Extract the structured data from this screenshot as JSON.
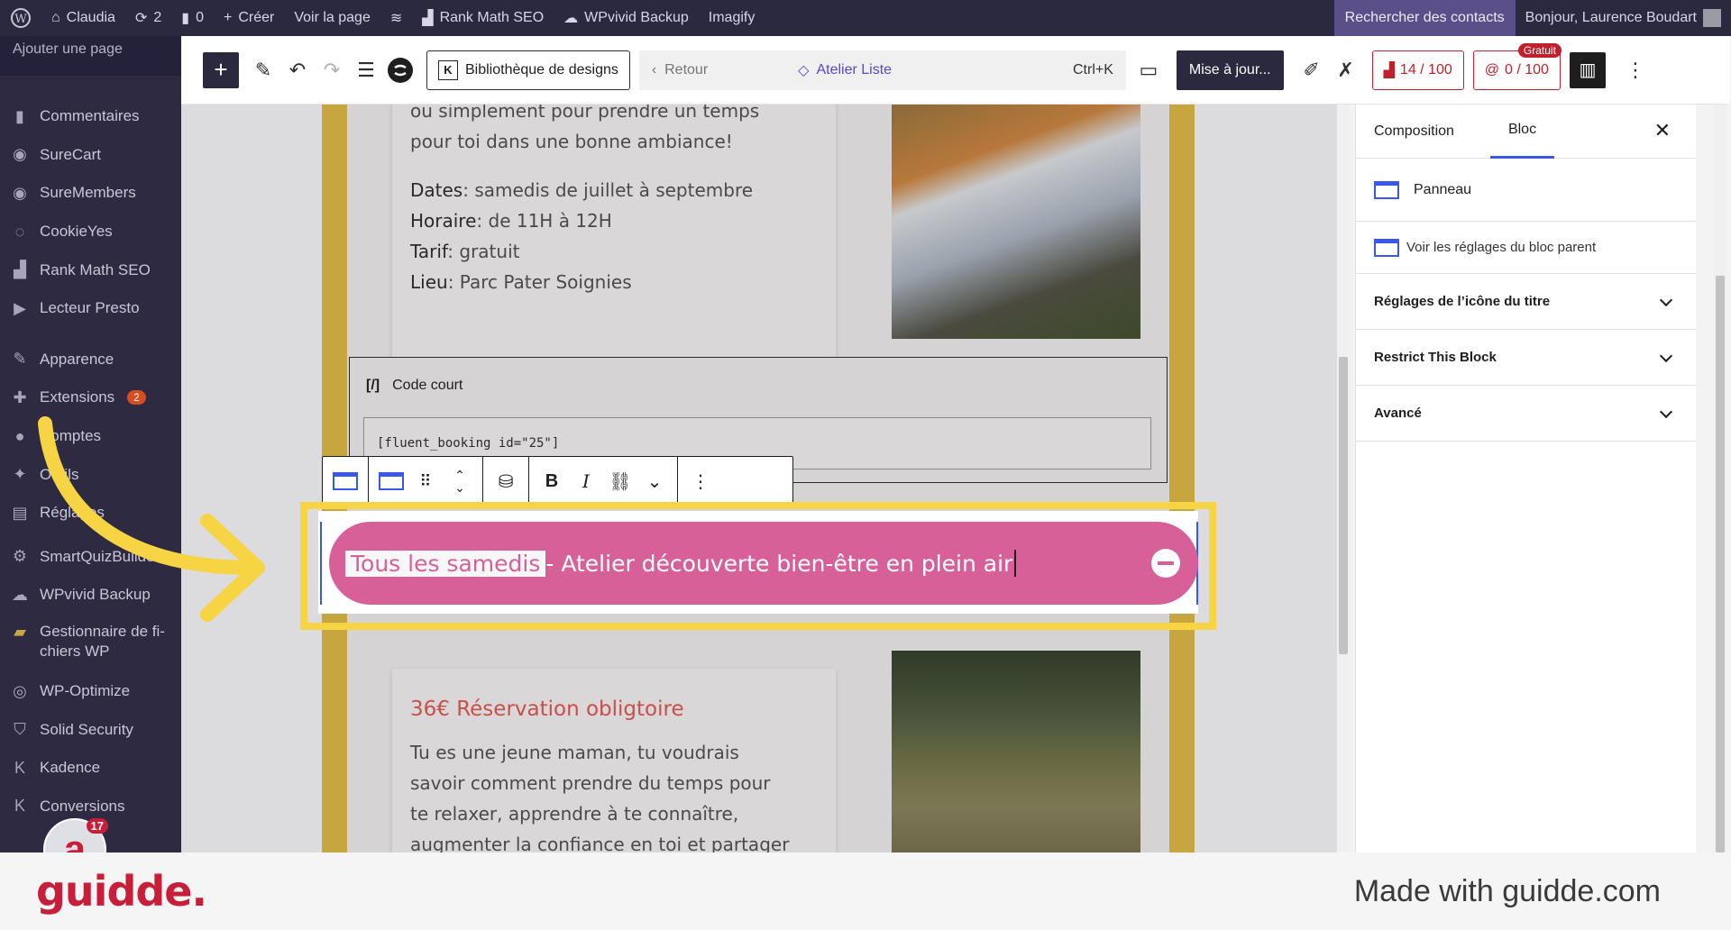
{
  "adminbar": {
    "site_name": "Claudia",
    "updates_count": "2",
    "comments_count": "0",
    "create_label": "Créer",
    "view_page_label": "Voir la page",
    "rank_math_label": "Rank Math SEO",
    "wpvivid_label": "WPvivid Backup",
    "imagify_label": "Imagify",
    "search_contacts_label": "Rechercher des contacts",
    "greeting": "Bonjour, Laurence Boudart"
  },
  "sidebar": {
    "sub_item": "Ajouter une page",
    "items": [
      {
        "label": "Commentaires",
        "icon": "comment-icon"
      },
      {
        "label": "SureCart",
        "icon": "surecart-icon"
      },
      {
        "label": "SureMembers",
        "icon": "suremembers-icon"
      },
      {
        "label": "CookieYes",
        "icon": "cookie-icon"
      },
      {
        "label": "Rank Math SEO",
        "icon": "chart-icon"
      },
      {
        "label": "Lecteur Presto",
        "icon": "presto-icon"
      },
      {
        "label": "Apparence",
        "icon": "brush-icon"
      },
      {
        "label": "Extensions",
        "icon": "plugin-icon",
        "badge": "2"
      },
      {
        "label": "Comptes",
        "icon": "user-icon"
      },
      {
        "label": "Outils",
        "icon": "wrench-icon"
      },
      {
        "label": "Réglages",
        "icon": "settings-icon"
      },
      {
        "label": "SmartQuizBuilder",
        "icon": "gear-icon"
      },
      {
        "label": "WPvivid Backup",
        "icon": "cloud-icon"
      },
      {
        "label": "Gestionnaire de fi-chiers WP",
        "icon": "folder-icon"
      },
      {
        "label": "WP-Optimize",
        "icon": "optimize-icon"
      },
      {
        "label": "Solid Security",
        "icon": "shield-icon"
      },
      {
        "label": "Kadence",
        "icon": "kadence-icon"
      },
      {
        "label": "Conversions",
        "icon": "conversions-icon"
      }
    ],
    "plugin_badge_count": "17"
  },
  "editor_header": {
    "design_library_label": "Bibliothèque de designs",
    "back_label": "Retour",
    "document_title": "Atelier Liste",
    "shortcut": "Ctrl+K",
    "update_label": "Mise à jour...",
    "seo_score": "14 / 100",
    "content_score": "0 / 100",
    "gratuit_label": "Gratuit"
  },
  "content": {
    "card1_text_top_a": "ou simplement pour prendre un temps",
    "card1_text_top_b": "pour toi dans une bonne ambiance!",
    "dates_label": "Dates",
    "dates_value": ": samedis de juillet à septembre",
    "horaire_label": "Horaire",
    "horaire_value": ": de 11H à 12H",
    "tarif_label": "Tarif",
    "tarif_value": ": gratuit",
    "lieu_label": "Lieu",
    "lieu_value": ": Parc Pater Soignies",
    "shortcode_block_label": "Code court",
    "shortcode_value": "[fluent_booking id=\"25\"]",
    "panel_title_highlight": "Tous les samedis",
    "panel_title_rest": " - Atelier découverte bien-être en plein air",
    "card2_heading": "36€ Réservation obligtoire",
    "card2_line1": "Tu es une jeune maman, tu voudrais",
    "card2_line2": "savoir comment prendre du temps pour",
    "card2_line3": "te relaxer, apprendre à te connaître,",
    "card2_line4": "augmenter la confiance en toi et partager"
  },
  "settings_panel": {
    "tab_composition": "Composition",
    "tab_bloc": "Bloc",
    "block_name": "Panneau",
    "parent_link": "Voir les réglages du bloc parent",
    "accordions": [
      "Réglages de l’icône du titre",
      "Restrict This Block",
      "Avancé"
    ]
  },
  "footer": {
    "brand": "guidde.",
    "made_with": "Made with guidde.com"
  },
  "colors": {
    "accent": "#3858e9",
    "panel_pink": "#d86099",
    "highlight_yellow": "#f7d443",
    "brand_red": "#c81e3a",
    "admin_dark": "#2b2940"
  }
}
